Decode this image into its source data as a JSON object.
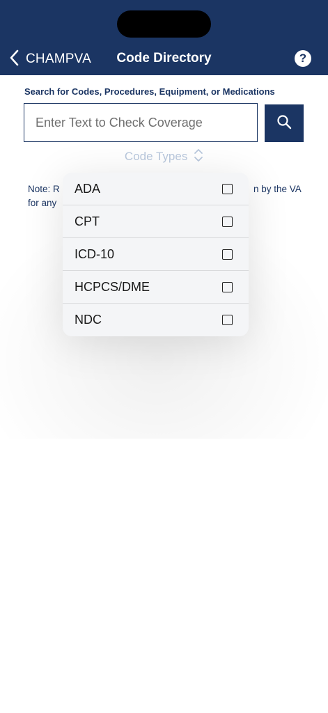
{
  "header": {
    "back_label": "CHAMPVA",
    "title": "Code Directory",
    "help_label": "?"
  },
  "search": {
    "heading": "Search for Codes, Procedures, Equipment, or Medications",
    "placeholder": "Enter Text to Check Coverage",
    "value": ""
  },
  "code_types": {
    "label": "Code Types"
  },
  "note": {
    "left_line1": "Note: R",
    "right_line1": "n by the VA",
    "left_line2": "for any"
  },
  "menu": {
    "items": [
      {
        "label": "ADA",
        "checked": false
      },
      {
        "label": "CPT",
        "checked": false
      },
      {
        "label": "ICD-10",
        "checked": false
      },
      {
        "label": "HCPCS/DME",
        "checked": false
      },
      {
        "label": "NDC",
        "checked": false
      }
    ]
  },
  "colors": {
    "brand_navy": "#1b3563",
    "code_types_text": "#b9c8dd",
    "menu_background": "#f4f5f7"
  }
}
